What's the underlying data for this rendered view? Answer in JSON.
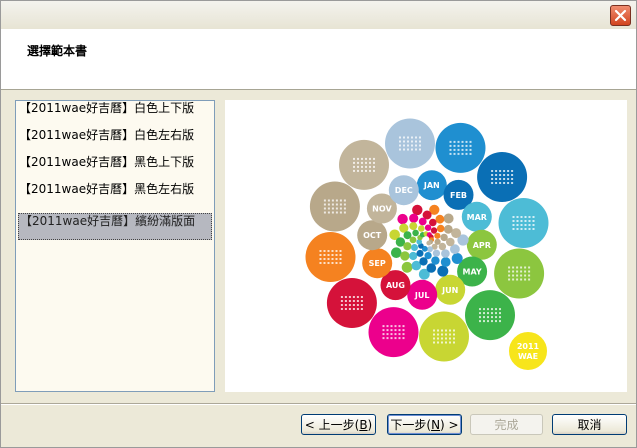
{
  "dialog": {
    "header_title": "選擇範本書"
  },
  "templates": [
    {
      "label": "【2011wae好吉曆】白色上下版",
      "selected": false
    },
    {
      "label": "【2011wae好吉曆】白色左右版",
      "selected": false
    },
    {
      "label": "【2011wae好吉曆】黑色上下版",
      "selected": false
    },
    {
      "label": "【2011wae好吉曆】黑色左右版",
      "selected": false
    },
    {
      "label": "【2011wae好吉曆】繽紛滿版面",
      "selected": true
    }
  ],
  "preview": {
    "months": [
      "JAN",
      "FEB",
      "MAR",
      "APR",
      "MAY",
      "JUN",
      "JUL",
      "AUG",
      "SEP",
      "OCT",
      "NOV",
      "DEC"
    ],
    "badge_line1": "2011",
    "badge_line2": "WAE",
    "colors": [
      "#a9c4dc",
      "#1f8fd0",
      "#0a6fb5",
      "#4dbcd6",
      "#8cc63f",
      "#3cb34a",
      "#c8d633",
      "#ec008c",
      "#d5123a",
      "#f58220",
      "#b8a88a",
      "#c2b59b"
    ]
  },
  "footer": {
    "back_label": "< 上一步(",
    "back_key": "B",
    "back_end": ")",
    "next_label": "下一步(",
    "next_key": "N",
    "next_end": ") >",
    "finish_label": "完成",
    "cancel_label": "取消"
  }
}
